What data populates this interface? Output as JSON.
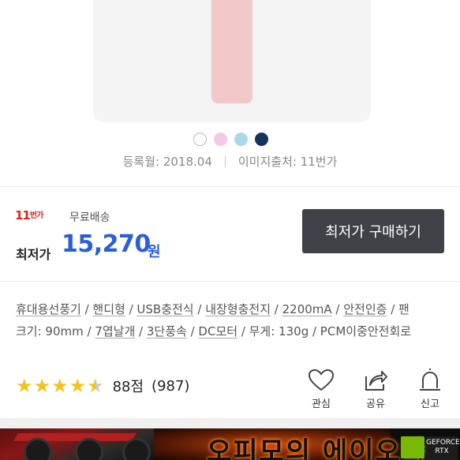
{
  "product": {
    "colors": [
      {
        "name": "white",
        "hex": "#ffffff"
      },
      {
        "name": "pink",
        "hex": "#f3c9e8"
      },
      {
        "name": "sky-blue",
        "hex": "#a9d8e8"
      },
      {
        "name": "navy",
        "hex": "#17325c"
      }
    ],
    "body_color": "#f2c8c9",
    "registered": "등록월: 2018.04",
    "image_source": "이미지출처: 11번가"
  },
  "seller": {
    "logo_main": "11",
    "logo_sub": "번가",
    "shipping": "무료배송",
    "price_label": "최저가",
    "price": "15,270",
    "currency": "원",
    "buy_button": "최저가 구매하기"
  },
  "specs": {
    "line1": [
      {
        "text": "휴대용선풍기",
        "link": true
      },
      {
        "text": " / ",
        "link": false
      },
      {
        "text": "핸디형",
        "link": true
      },
      {
        "text": " / ",
        "link": false
      },
      {
        "text": "USB충전식",
        "link": true
      },
      {
        "text": " / ",
        "link": false
      },
      {
        "text": "내장형충전지",
        "link": true
      },
      {
        "text": " / ",
        "link": false
      },
      {
        "text": "2200mA",
        "link": true
      },
      {
        "text": " / ",
        "link": false
      },
      {
        "text": "안전인증",
        "link": true
      },
      {
        "text": " / 팬",
        "link": false
      }
    ],
    "line2": [
      {
        "text": "크기: 90mm / ",
        "link": false
      },
      {
        "text": "7엽날개",
        "link": true
      },
      {
        "text": " / ",
        "link": false
      },
      {
        "text": "3단풍속",
        "link": true
      },
      {
        "text": " / ",
        "link": false
      },
      {
        "text": "DC모터",
        "link": true
      },
      {
        "text": " / 무게: 130g / PCM이중안전회로",
        "link": false
      }
    ]
  },
  "rating": {
    "stars": 4.5,
    "score": "88점",
    "count": "(987)"
  },
  "actions": {
    "like": "관심",
    "share": "공유",
    "report": "신고"
  },
  "banner": {
    "headline": "오피모의 에이오다",
    "badge": "GEFORCE RTX"
  },
  "colors": {
    "price": "#2a5fd8",
    "button_bg": "#3e4147",
    "brand_red": "#e02020",
    "star": "#f4c21b"
  }
}
